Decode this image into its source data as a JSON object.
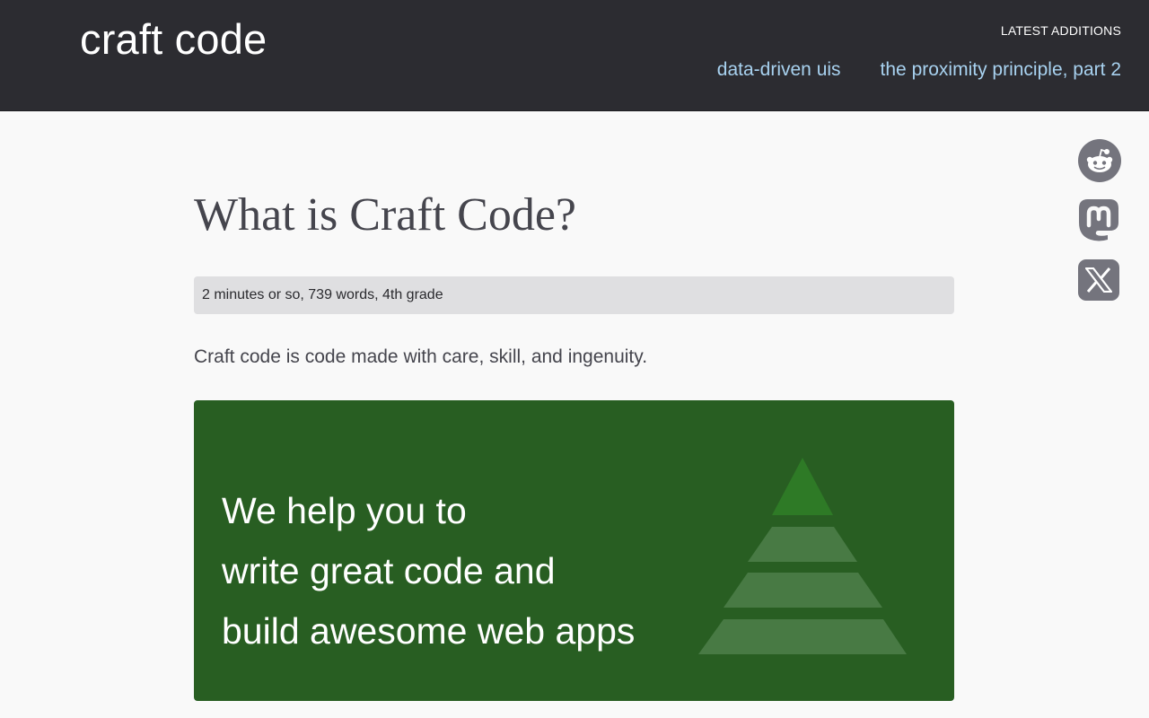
{
  "header": {
    "site_title": "craft code",
    "latest_label": "LATEST ADDITIONS",
    "latest_links": [
      "data-driven uis",
      "the proximity principle, part 2"
    ]
  },
  "share": {
    "icons": [
      "reddit-icon",
      "mastodon-icon",
      "x-icon"
    ],
    "icon_color": "#74747d"
  },
  "article": {
    "title": "What is Craft Code?",
    "meta": "2 minutes or so, 739 words, 4th grade",
    "intro": "Craft code is code made with care, skill, and ingenuity.",
    "hero": {
      "lines": [
        "We help you to",
        "write great code and",
        "build awesome web apps"
      ],
      "background": "#285e22",
      "pyramid_colors": [
        "#2e7a26",
        "#487a44"
      ]
    }
  },
  "colors": {
    "header_bg": "#2c2c31",
    "page_bg": "#f9f9f9",
    "link": "#a8d2f0",
    "title_text": "#45454d",
    "meta_bg": "#dfdfe1"
  }
}
